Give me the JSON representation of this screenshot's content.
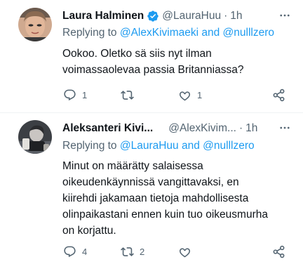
{
  "tweets": [
    {
      "name": "Laura Halminen",
      "handle": "@LauraHuu",
      "dot": "·",
      "time": "1h",
      "verified": true,
      "replying_prefix": "Replying to ",
      "replying_mention": "@AlexKivimaeki and @nulllzero",
      "text": "Ookoo. Oletko sä siis nyt ilman voimassaolevaa passia Britanniassa?",
      "reply_count": "1",
      "retweet_count": "",
      "like_count": "1"
    },
    {
      "name": "Aleksanteri Kivi...",
      "handle": "@AlexKivim...",
      "dot": "·",
      "time": "1h",
      "verified": false,
      "replying_prefix": "Replying to ",
      "replying_mention": "@LauraHuu and @nulllzero",
      "text": "Minut on määrätty salaisessa oikeudenkäynnissä vangittavaksi, en kiirehdi jakamaan tietoja mahdollisesta olinpaikastani ennen kuin tuo oikeusmurha on korjattu.",
      "reply_count": "4",
      "retweet_count": "2",
      "like_count": ""
    }
  ],
  "icons": {
    "reply": "reply-icon",
    "retweet": "retweet-icon",
    "like": "heart-icon",
    "share": "share-icon",
    "more": "more-icon",
    "verified": "verified-badge-icon"
  },
  "colors": {
    "text": "#0f1419",
    "secondary": "#536471",
    "accent": "#1d9bf0",
    "divider": "#eff3f4"
  }
}
